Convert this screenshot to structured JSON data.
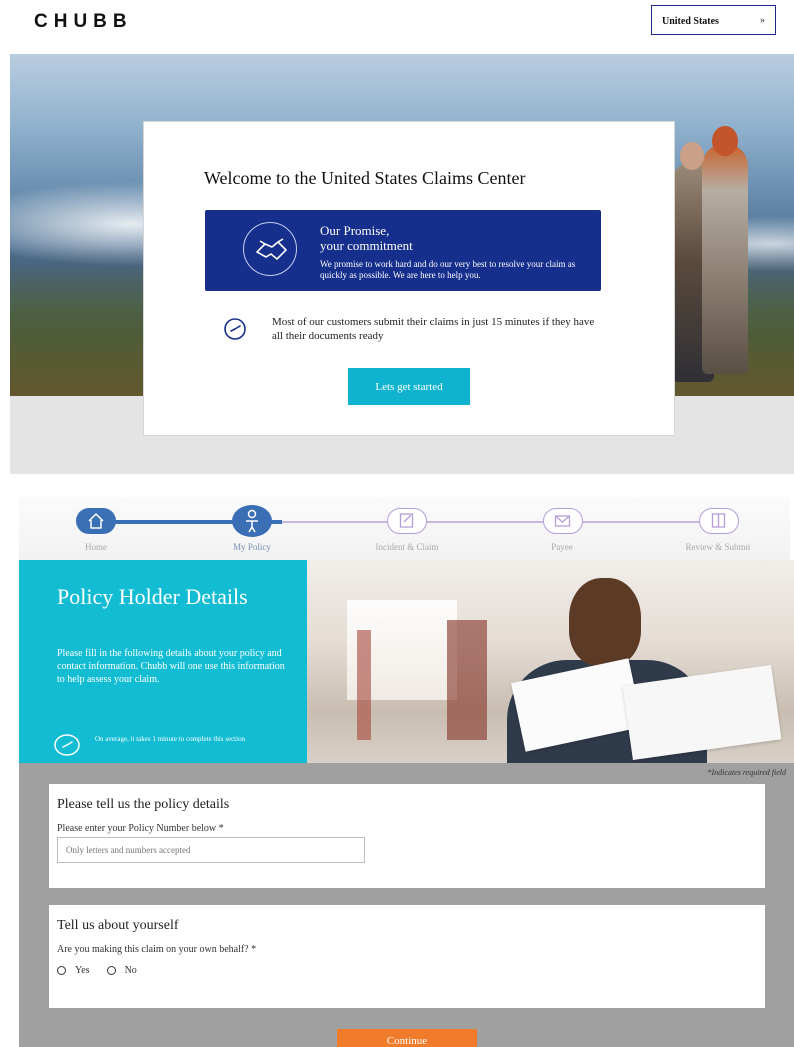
{
  "header": {
    "logo": "CHUBB",
    "country_select": {
      "value": "United States",
      "chevron": "»"
    }
  },
  "welcome": {
    "title": "Welcome to the United States Claims Center",
    "promise": {
      "line1": "Our Promise,",
      "line2": "your commitment",
      "description": "We promise to work hard and do our very best to resolve your claim as quickly as possible. We are here to help you.",
      "icon": "handshake-icon"
    },
    "minutes_text": "Most of our customers submit their claims in just 15 minutes if they have all their documents ready",
    "start_button": "Lets get started"
  },
  "steps": {
    "items": [
      {
        "label": "Home",
        "icon": "home-icon",
        "state": "done"
      },
      {
        "label": "My Policy",
        "icon": "person-icon",
        "state": "active"
      },
      {
        "label": "Incident & Claim",
        "icon": "edit-icon",
        "state": "todo"
      },
      {
        "label": "Payee",
        "icon": "envelope-icon",
        "state": "todo"
      },
      {
        "label": "Review & Submit",
        "icon": "document-icon",
        "state": "todo"
      }
    ]
  },
  "policy_holder": {
    "title": "Policy Holder Details",
    "description": "Please fill in the following details about your policy and contact information. Chubb will one use this information to help assess your claim.",
    "time_note": "On average, it takes 1 minute to complete this section"
  },
  "form": {
    "required_note": "*Indicates required field",
    "policy_card": {
      "title": "Please tell us the policy details",
      "label": "Please enter your Policy Number below *",
      "placeholder": "Only letters and numbers accepted",
      "value": ""
    },
    "about_card": {
      "title": "Tell us about yourself",
      "question": "Are you making this claim on your own behalf? *",
      "options": [
        "Yes",
        "No"
      ]
    },
    "continue_button": "Continue"
  },
  "colors": {
    "navy": "#162e8c",
    "teal": "#12bcd3",
    "orange": "#f07b2a",
    "step_blue": "#3a6fb6",
    "step_lavender": "#b69ed9"
  }
}
